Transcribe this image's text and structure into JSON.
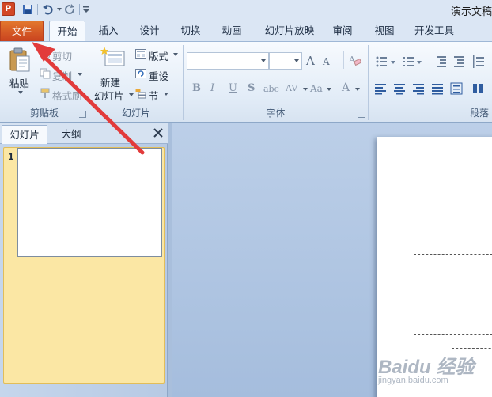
{
  "app": {
    "title": "演示文稿",
    "logo_letter": "P"
  },
  "quick_access": {
    "icons": [
      "save-icon",
      "undo-icon",
      "redo-icon",
      "customize-icon"
    ]
  },
  "tabs": [
    {
      "label": "文件"
    },
    {
      "label": "开始"
    },
    {
      "label": "插入"
    },
    {
      "label": "设计"
    },
    {
      "label": "切换"
    },
    {
      "label": "动画"
    },
    {
      "label": "幻灯片放映"
    },
    {
      "label": "审阅"
    },
    {
      "label": "视图"
    },
    {
      "label": "开发工具"
    }
  ],
  "ribbon": {
    "clipboard": {
      "paste": "粘贴",
      "cut": "剪切",
      "copy": "复制",
      "format_painter": "格式刷",
      "label": "剪贴板"
    },
    "slides": {
      "new_slide_line1": "新建",
      "new_slide_line2": "幻灯片",
      "layout": "版式",
      "reset": "重设",
      "section": "节",
      "label": "幻灯片"
    },
    "font": {
      "grow": "A",
      "shrink": "A",
      "bold": "B",
      "italic": "I",
      "underline": "U",
      "shadow": "S",
      "strike": "abc",
      "spacing": "AV",
      "case": "Aa",
      "color": "A",
      "label": "字体"
    },
    "paragraph": {
      "label": "段落"
    }
  },
  "left_pane": {
    "tab_slides": "幻灯片",
    "tab_outline": "大纲",
    "slide_number": "1"
  },
  "watermark": {
    "logo": "Baidu 经验",
    "sub": "jingyan.baidu.com"
  },
  "colors": {
    "file_tab": "#d5532a",
    "accent_arrow": "#e03a3a",
    "ribbon_bg": "#e2ecf7"
  }
}
